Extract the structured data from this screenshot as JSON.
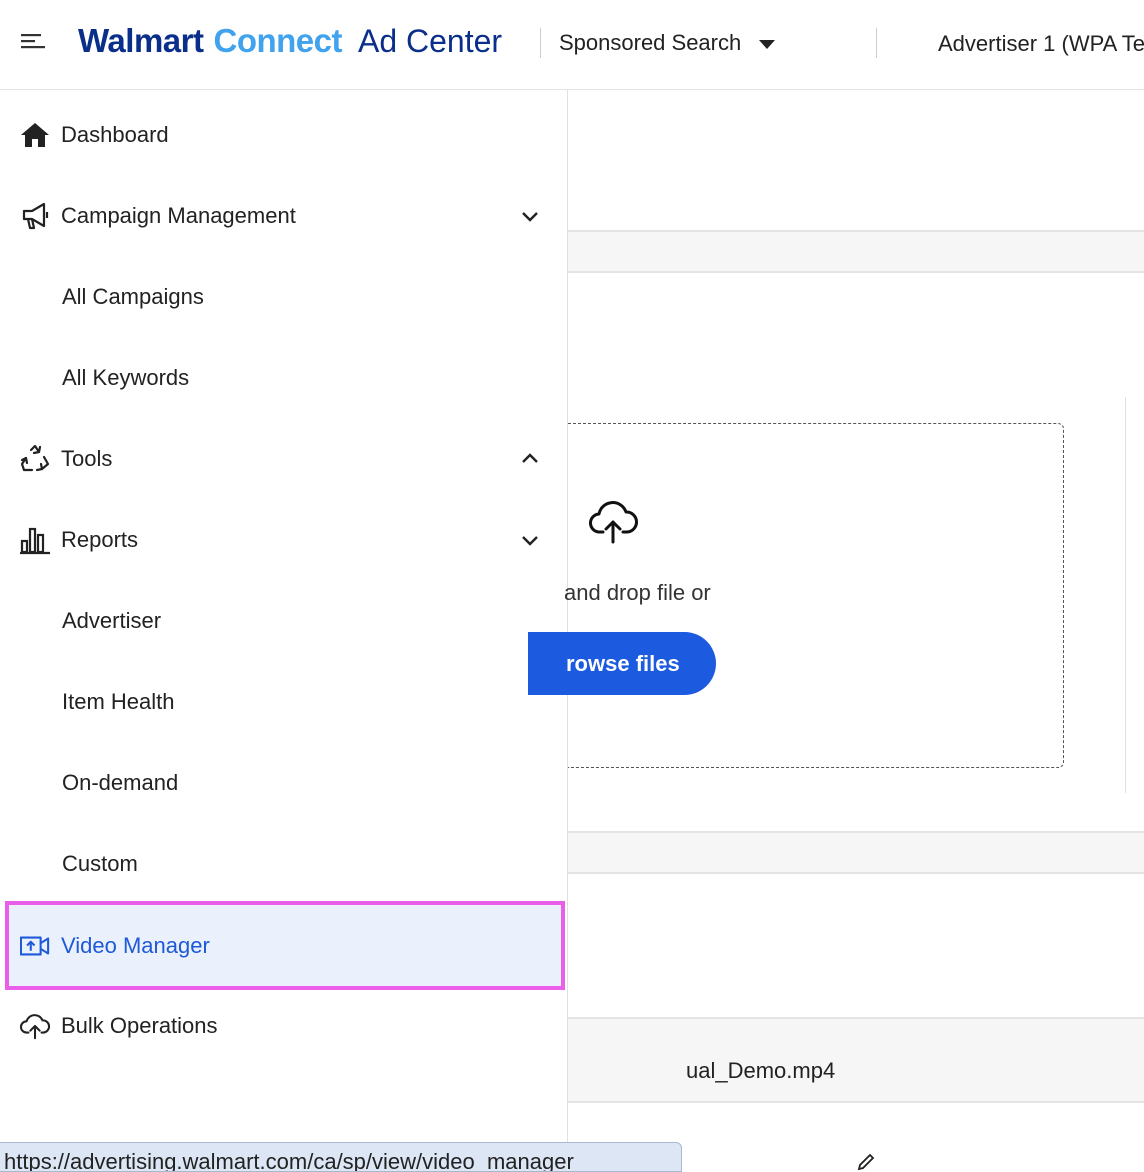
{
  "header": {
    "brand_walmart": "Walmart",
    "brand_connect": "Connect",
    "brand_adcenter": "Ad Center",
    "product_selector": "Sponsored Search",
    "advertiser": "Advertiser 1 (WPA Te"
  },
  "sidebar": {
    "items": [
      {
        "label": "Dashboard",
        "icon": "home-icon"
      },
      {
        "label": "Campaign Management",
        "icon": "megaphone-icon",
        "expanded": false
      },
      {
        "label": "All Campaigns"
      },
      {
        "label": "All Keywords"
      },
      {
        "label": "Tools",
        "icon": "recycle-icon",
        "expanded": true
      },
      {
        "label": "Reports",
        "icon": "bar-chart-icon",
        "expanded": false
      },
      {
        "label": "Advertiser"
      },
      {
        "label": "Item Health"
      },
      {
        "label": "On-demand"
      },
      {
        "label": "Custom"
      },
      {
        "label": "Video Manager",
        "icon": "video-upload-icon",
        "active": true
      },
      {
        "label": "Bulk Operations",
        "icon": "cloud-upload-icon"
      }
    ]
  },
  "main": {
    "drop_text": "and drop file or",
    "browse_label": "rowse files",
    "file_name": "ual_Demo.mp4"
  },
  "status_bar": {
    "url": "https://advertising.walmart.com/ca/sp/view/video_manager"
  },
  "colors": {
    "brand_navy": "#0a2f8a",
    "brand_light_blue": "#41a3ee",
    "primary_blue": "#1c5ae0",
    "active_bg": "#ebf1fc",
    "highlight": "#ea5eea"
  }
}
